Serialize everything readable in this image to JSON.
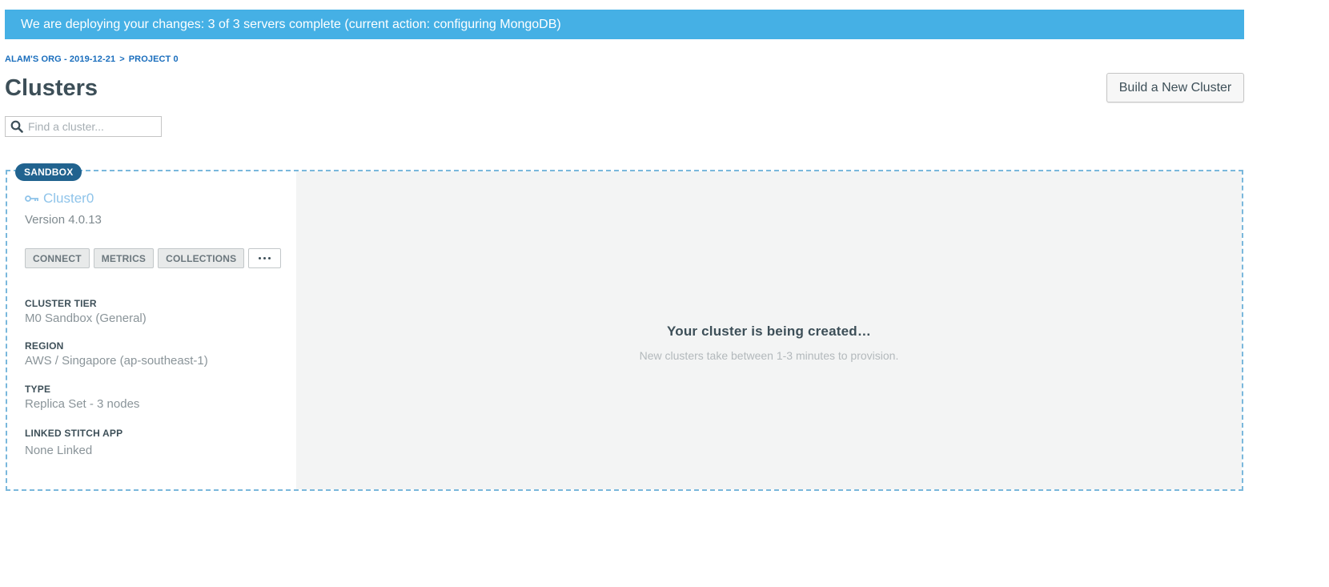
{
  "banner": {
    "message": "We are deploying your changes: 3 of 3 servers complete (current action: configuring MongoDB)"
  },
  "breadcrumb": {
    "org": "ALAM'S ORG - 2019-12-21",
    "separator": ">",
    "project": "PROJECT 0"
  },
  "header": {
    "title": "Clusters",
    "build_button": "Build a New Cluster"
  },
  "search": {
    "placeholder": "Find a cluster..."
  },
  "cluster": {
    "badge": "SANDBOX",
    "name": "Cluster0",
    "version": "Version 4.0.13",
    "actions": {
      "connect": "CONNECT",
      "metrics": "METRICS",
      "collections": "COLLECTIONS"
    },
    "details": [
      {
        "label": "CLUSTER TIER",
        "value": "M0 Sandbox (General)"
      },
      {
        "label": "REGION",
        "value": "AWS / Singapore (ap-southeast-1)"
      },
      {
        "label": "TYPE",
        "value": "Replica Set - 3 nodes"
      },
      {
        "label": "LINKED STITCH APP",
        "value": "None Linked"
      }
    ],
    "status": {
      "title": "Your cluster is being created…",
      "subtitle": "New clusters take between 1-3 minutes to provision."
    }
  },
  "colors": {
    "banner": "#45b0e5",
    "badge": "#21638f",
    "link": "#1a6ebd",
    "cluster_name": "#8fc4ea"
  },
  "icons": {
    "search": "search-icon",
    "cluster": "key-icon",
    "more": "ellipsis-icon"
  }
}
